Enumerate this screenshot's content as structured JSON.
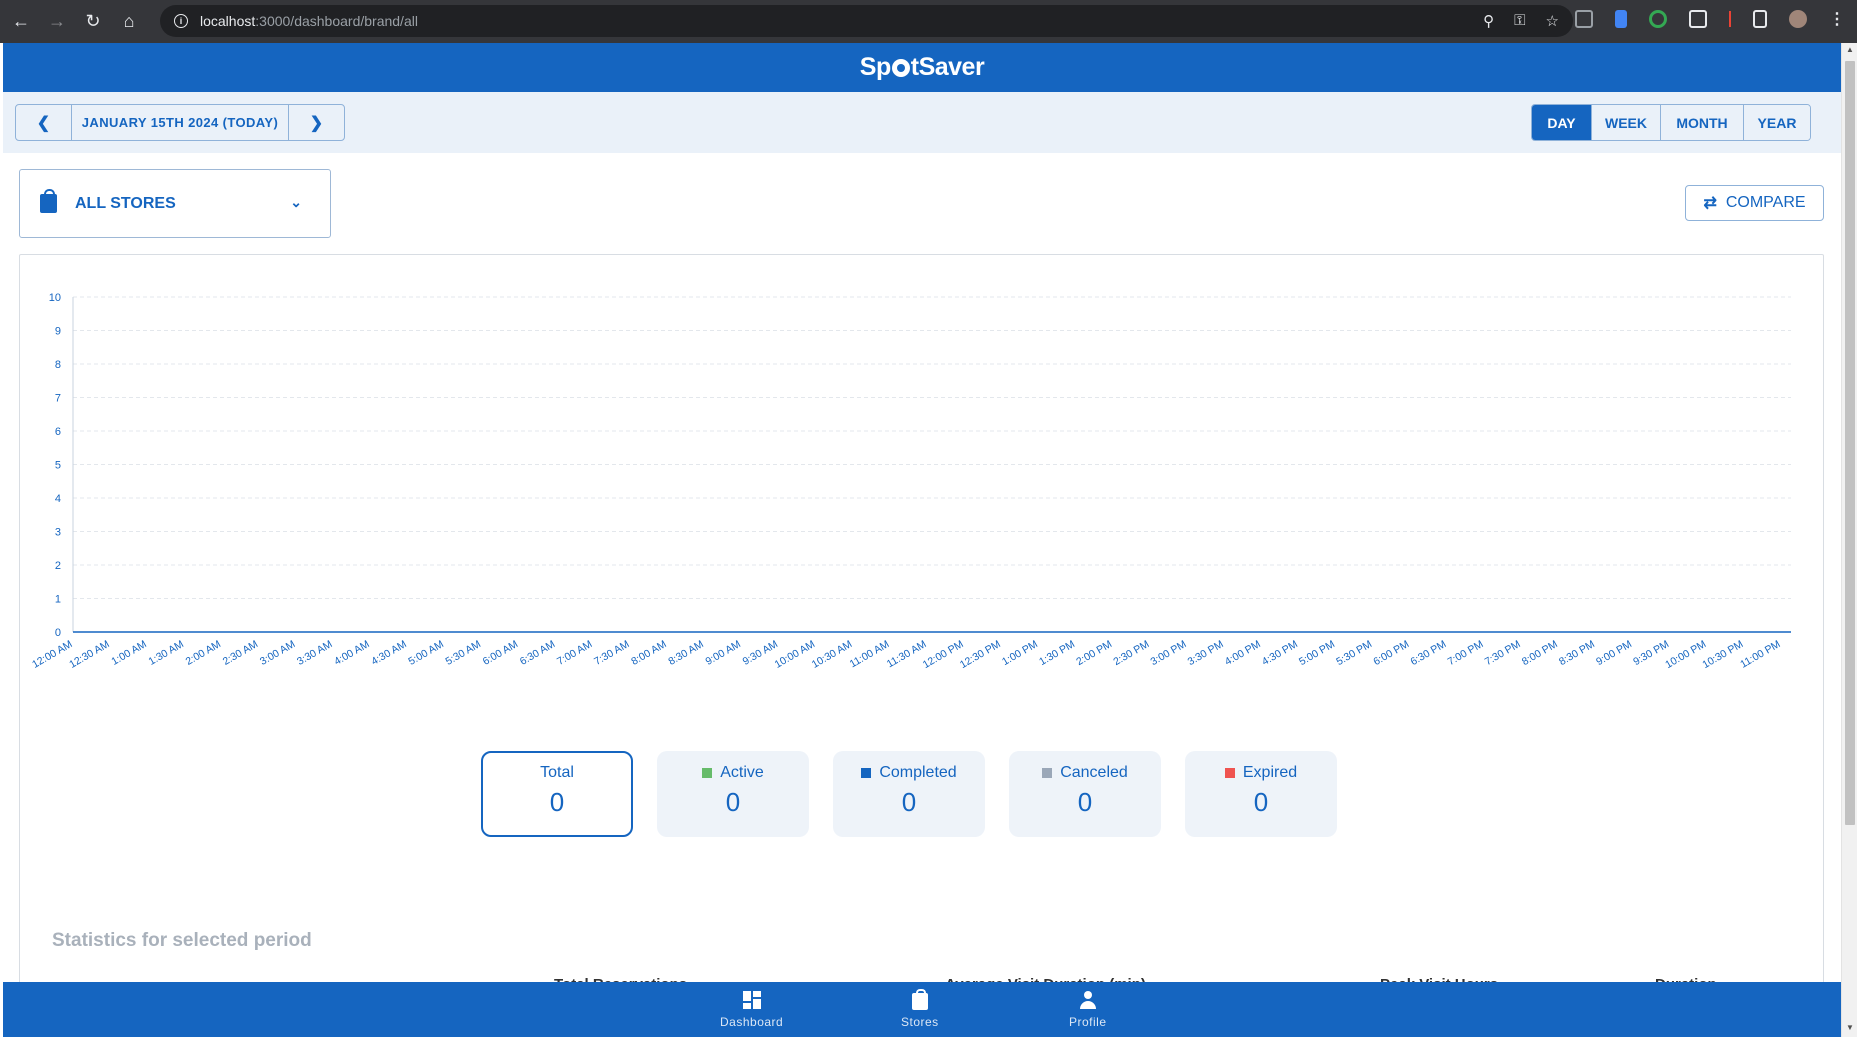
{
  "browser": {
    "url_host": "localhost",
    "url_path": ":3000/dashboard/brand/all"
  },
  "app": {
    "logo_left": "Sp",
    "logo_right": "tSaver"
  },
  "toolbar": {
    "date_label": "JANUARY 15TH 2024 (TODAY)",
    "periods": [
      "DAY",
      "WEEK",
      "MONTH",
      "YEAR"
    ],
    "active_period": "DAY"
  },
  "filters": {
    "store_label": "ALL STORES",
    "compare_label": "COMPARE"
  },
  "chart_data": {
    "type": "line",
    "title": "",
    "xlabel": "",
    "ylabel": "",
    "ylim": [
      0,
      10
    ],
    "y_ticks": [
      "0",
      "1",
      "2",
      "3",
      "4",
      "5",
      "6",
      "7",
      "8",
      "9",
      "10"
    ],
    "categories": [
      "12:00 AM",
      "12:30 AM",
      "1:00 AM",
      "1:30 AM",
      "2:00 AM",
      "2:30 AM",
      "3:00 AM",
      "3:30 AM",
      "4:00 AM",
      "4:30 AM",
      "5:00 AM",
      "5:30 AM",
      "6:00 AM",
      "6:30 AM",
      "7:00 AM",
      "7:30 AM",
      "8:00 AM",
      "8:30 AM",
      "9:00 AM",
      "9:30 AM",
      "10:00 AM",
      "10:30 AM",
      "11:00 AM",
      "11:30 AM",
      "12:00 PM",
      "12:30 PM",
      "1:00 PM",
      "1:30 PM",
      "2:00 PM",
      "2:30 PM",
      "3:00 PM",
      "3:30 PM",
      "4:00 PM",
      "4:30 PM",
      "5:00 PM",
      "5:30 PM",
      "6:00 PM",
      "6:30 PM",
      "7:00 PM",
      "7:30 PM",
      "8:00 PM",
      "8:30 PM",
      "9:00 PM",
      "9:30 PM",
      "10:00 PM",
      "10:30 PM",
      "11:00 PM"
    ],
    "series": [],
    "grid": true,
    "grid_style": "dashed-horizontal",
    "axis_color": "#1565c0"
  },
  "cards": [
    {
      "key": "total",
      "label": "Total",
      "value": "0",
      "color": ""
    },
    {
      "key": "active",
      "label": "Active",
      "value": "0",
      "color": "#66bb6a"
    },
    {
      "key": "completed",
      "label": "Completed",
      "value": "0",
      "color": "#1565c0"
    },
    {
      "key": "canceled",
      "label": "Canceled",
      "value": "0",
      "color": "#9aa7b8"
    },
    {
      "key": "expired",
      "label": "Expired",
      "value": "0",
      "color": "#ef5350"
    }
  ],
  "stats": {
    "title": "Statistics for selected period",
    "headers": [
      "Total Reservations",
      "Average Visit Duration (min)",
      "Peak Visit Hours",
      "Duration"
    ]
  },
  "bottom_nav": {
    "items": [
      "Dashboard",
      "Stores",
      "Profile"
    ]
  },
  "icons": {
    "back": "arrow-left-icon",
    "forward": "arrow-right-icon",
    "reload": "reload-icon",
    "home": "home-icon",
    "store": "shopping-bag-icon",
    "compare": "compare-arrows-icon",
    "dashboard": "dashboard-icon",
    "profile": "person-icon"
  }
}
